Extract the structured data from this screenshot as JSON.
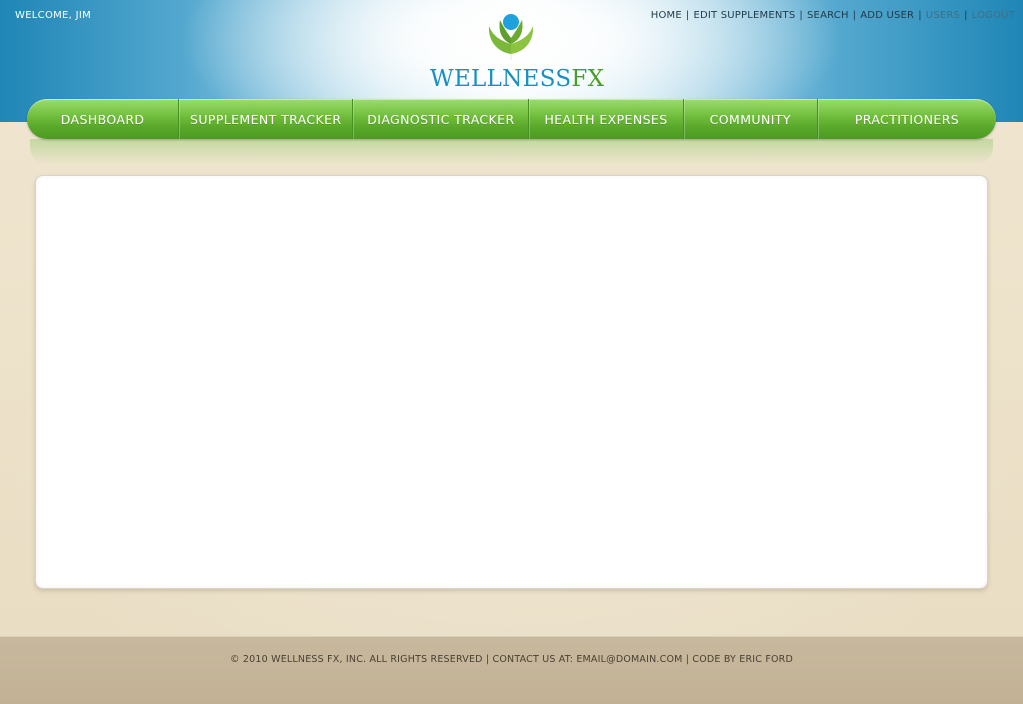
{
  "header": {
    "welcome": "WELCOME, JIM",
    "brand": {
      "part1": "WELLNESS",
      "part2": "FX"
    },
    "top_links": [
      {
        "label": "HOME"
      },
      {
        "label": "EDIT SUPPLEMENTS"
      },
      {
        "label": "SEARCH"
      },
      {
        "label": "ADD USER"
      },
      {
        "label": "USERS"
      },
      {
        "label": "LOGOUT"
      }
    ],
    "separator": "|"
  },
  "nav": {
    "items": [
      {
        "label": "DASHBOARD"
      },
      {
        "label": "SUPPLEMENT TRACKER"
      },
      {
        "label": "DIAGNOSTIC TRACKER"
      },
      {
        "label": "HEALTH EXPENSES"
      },
      {
        "label": "COMMUNITY"
      },
      {
        "label": "PRACTITIONERS"
      }
    ]
  },
  "footer": {
    "text": "© 2010 WELLNESS FX, INC. ALL RIGHTS RESERVED | CONTACT US AT: EMAIL@DOMAIN.COM | CODE BY ERIC FORD"
  },
  "colors": {
    "brand_blue": "#1b8fc1",
    "brand_green": "#4b9c2e",
    "nav_green": "#5aa82a",
    "footer_tan": "#c8b89d"
  },
  "icons": {
    "logo": "leaf-logo-icon"
  }
}
